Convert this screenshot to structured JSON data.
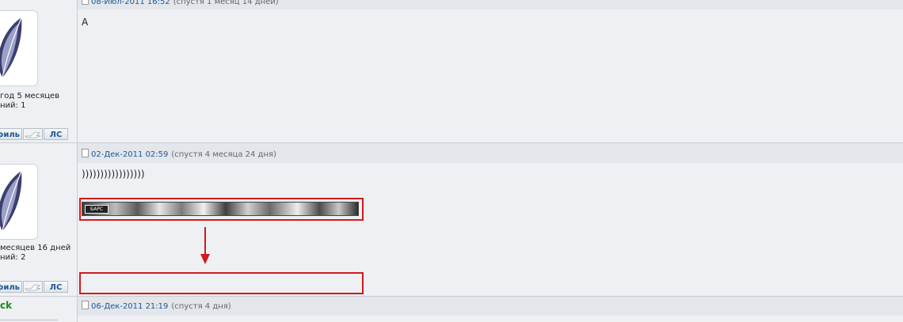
{
  "posts": [
    {
      "date": "08-Июл-2011 16:52",
      "relative": "(спустя 1 месяц 14 дней)",
      "body": "A",
      "author": {
        "stat1": "год 5 месяцев",
        "stat2": "ний: 1"
      }
    },
    {
      "date": "02-Дек-2011 02:59",
      "relative": "(спустя 4 месяца 24 дня)",
      "body": ")))))))))))))))))",
      "signature_label": "БАРС",
      "author": {
        "stat1": "месяцев 16 дней",
        "stat2": "ний: 2"
      }
    },
    {
      "date": "06-Дек-2011 21:19",
      "relative": "(спустя 4 дня)",
      "author": {
        "name": "ck"
      }
    }
  ],
  "buttons": {
    "profile": "филь",
    "pm": "ЛС"
  },
  "icons": [
    "feather-icon",
    "hand-icon",
    "document-icon",
    "arrow-down-icon"
  ],
  "colors": {
    "link": "#1c5896",
    "highlight": "#d11a1a",
    "username": "#1b8a1b"
  }
}
